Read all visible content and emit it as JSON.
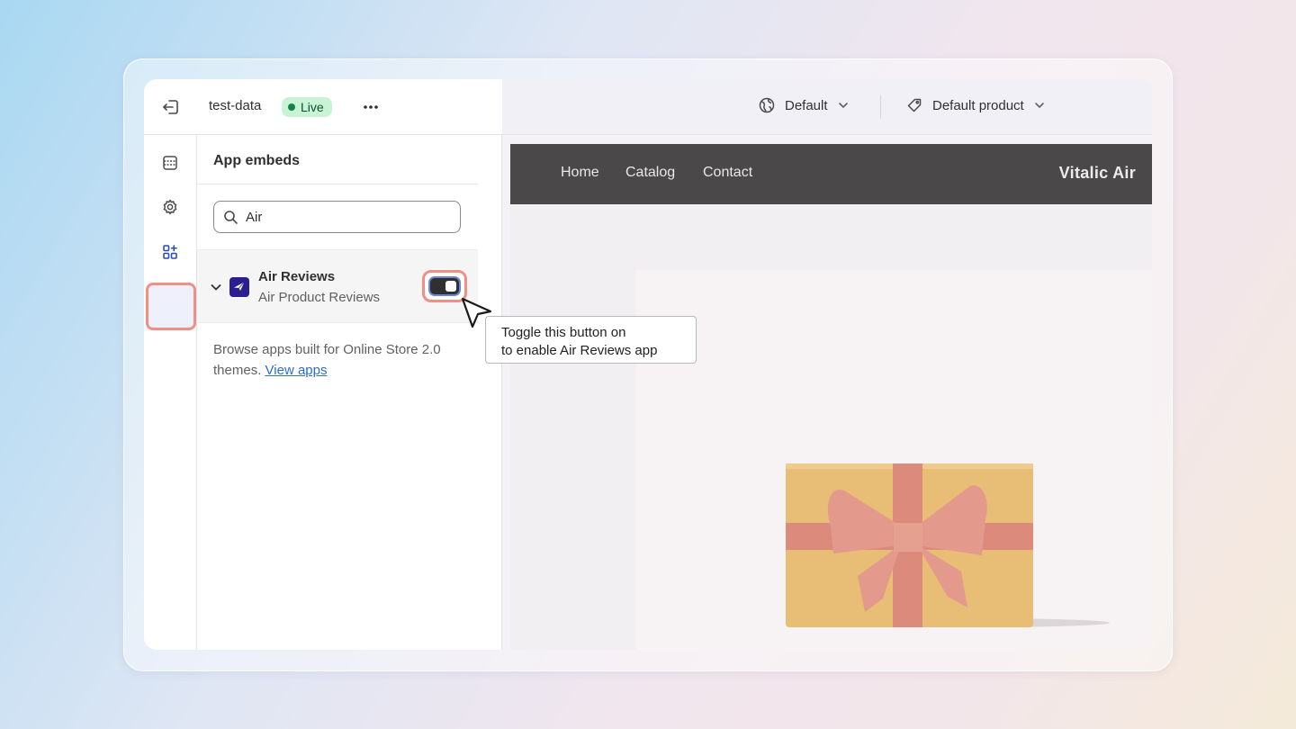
{
  "header": {
    "store_name": "test-data",
    "live_label": "Live",
    "locale_label": "Default",
    "product_label": "Default product"
  },
  "rail": {
    "items": [
      "sections",
      "theme-settings",
      "app-embeds"
    ],
    "active": "app-embeds"
  },
  "panel": {
    "title": "App embeds",
    "search": {
      "value": "Air",
      "placeholder": "Search"
    },
    "app": {
      "name": "Air Reviews",
      "subtitle": "Air Product Reviews",
      "enabled": false
    },
    "browse_text": "Browse apps built for Online Store 2.0 themes.",
    "browse_link": "View apps"
  },
  "preview": {
    "nav_links": [
      "Home",
      "Catalog",
      "Contact"
    ],
    "brand": "Vitalic Air"
  },
  "tooltip": {
    "line1": "Toggle this button on",
    "line2": "to enable Air Reviews app"
  },
  "colors": {
    "highlight": "#ee8f88",
    "live_badge_bg": "#c9f3d5",
    "nav_bg": "#4a4849",
    "link": "#2c6ecb",
    "gift_box": "#e8bd76",
    "gift_ribbon": "#dc8a7c"
  }
}
